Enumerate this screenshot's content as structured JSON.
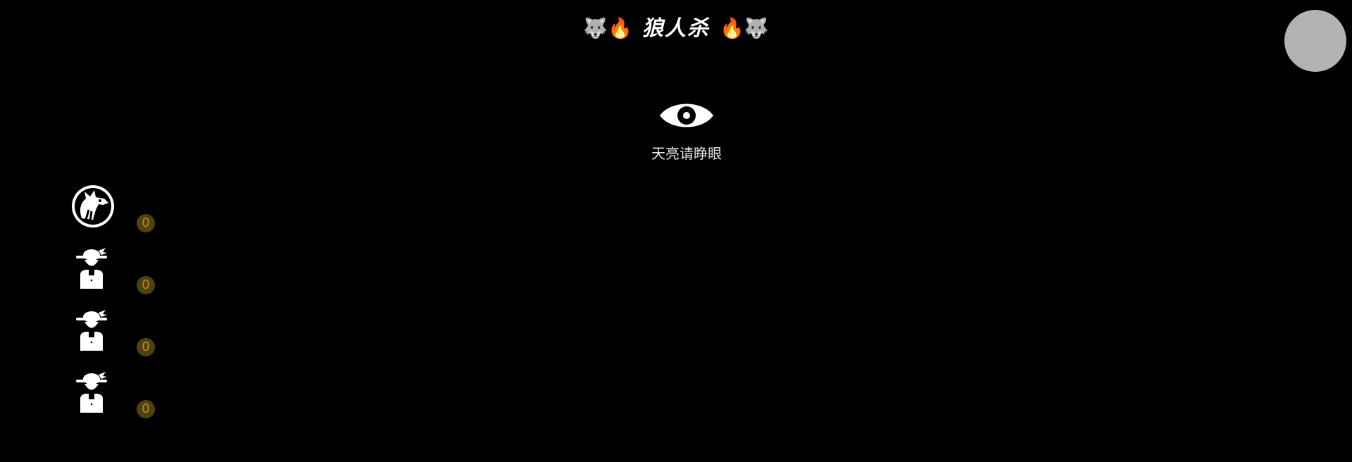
{
  "header": {
    "left_deco": "🐺🔥",
    "title": "狼人杀",
    "right_deco": "🔥🐺"
  },
  "phase": {
    "icon": "eye-icon",
    "text": "天亮请睁眼"
  },
  "players": [
    {
      "role_icon": "werewolf-icon",
      "votes": "0"
    },
    {
      "role_icon": "villager-icon",
      "votes": "0"
    },
    {
      "role_icon": "villager-icon",
      "votes": "0"
    },
    {
      "role_icon": "villager-icon",
      "votes": "0"
    }
  ],
  "colors": {
    "background": "#000000",
    "avatar_button": "#b3b3b3",
    "badge_bg": "#4f4212",
    "badge_text": "#c08a1a"
  }
}
